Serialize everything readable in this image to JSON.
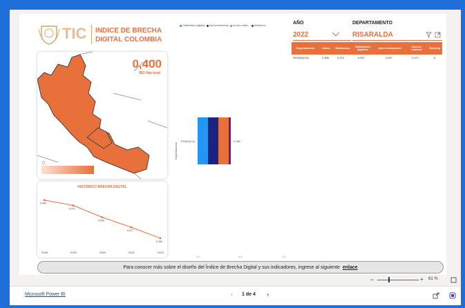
{
  "header": {
    "logo_text": "TIC",
    "title_line1": "INDICE DE BRECHA",
    "title_line2": "DIGITAL COLOMBIA"
  },
  "map_card": {
    "value": "0,400",
    "value_label": "IBD Nacional",
    "scale_min": "0"
  },
  "history": {
    "title": "HISTÓRICO BRECHA DIGITAL"
  },
  "legend": [
    {
      "label": "Habilidades digitales",
      "color": "#2196f3"
    },
    {
      "label": "Aprovechamiento",
      "color": "#1a237e"
    },
    {
      "label": "Acceso mater...",
      "color": "#e8703a"
    },
    {
      "label": "Motivación",
      "color": "#6a1b9a"
    }
  ],
  "stacked_bar": {
    "category": "RISARALDA",
    "axis_label": "Departamento",
    "total_label": "0,366",
    "x_ticks": [
      "0,0",
      "0,5",
      "1,0"
    ]
  },
  "filters": {
    "year_label": "AÑO",
    "year_value": "2022",
    "dept_label": "DEPARTAMENTO",
    "dept_value": "RISARALDA"
  },
  "table": {
    "headers": [
      "Departamento",
      "Indice",
      "Motivación",
      "Habilidades digitales",
      "Aprovechamiento",
      "Acceso material",
      "Ranking"
    ],
    "rows": [
      [
        "RISARALDA",
        "0,366",
        "0,072",
        "0,507",
        "0,457",
        "0,471",
        "5"
      ]
    ]
  },
  "footer_text": "Para conocer más sobre el diseño del Índice de Brecha Digital y sus indicadores, ingrese al siguiente ",
  "footer_link": "enlace",
  "zoom": "61 %",
  "bottom": {
    "brand": "Microsoft Power BI",
    "pagination": "1 de 4"
  },
  "chart_data": {
    "type": "line",
    "title": "HISTÓRICO BRECHA DIGITAL",
    "x": [
      "2018",
      "2019",
      "2020",
      "2021",
      "2022"
    ],
    "series": [
      {
        "values": [
          0.494,
          0.471,
          0.42,
          0.377,
          0.33
        ]
      }
    ],
    "point_labels": [
      "0,494",
      "0,471",
      "0,420",
      "0,377",
      "0,330"
    ],
    "ylim": [
      0.3,
      0.52
    ]
  }
}
